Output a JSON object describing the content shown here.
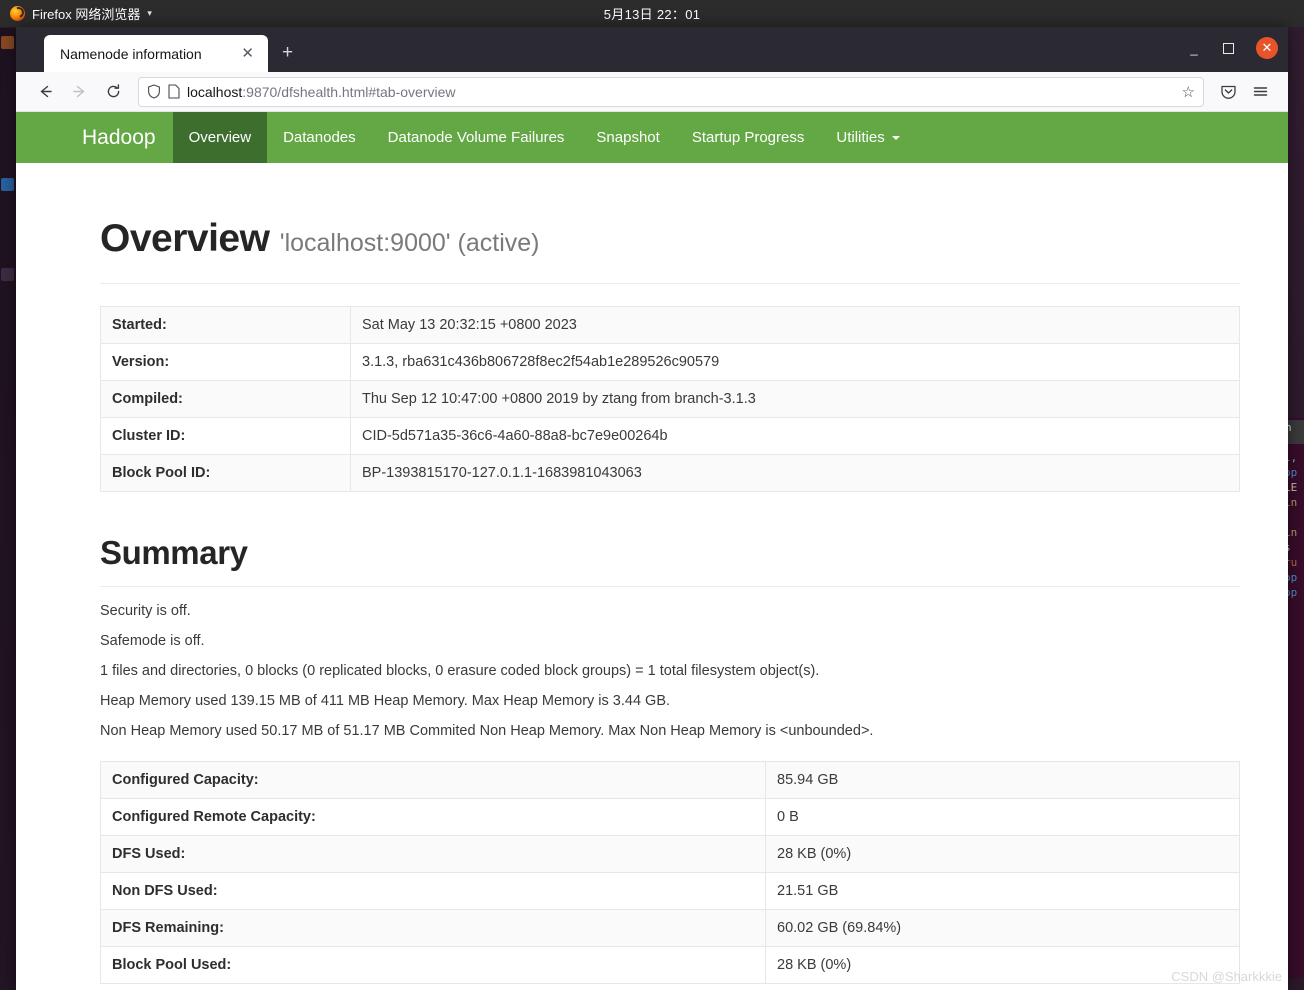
{
  "desktop": {
    "topbar": {
      "app_name": "Firefox 网络浏览器",
      "app_icon": "firefox-icon",
      "menu_caret": "▾",
      "clock": "5月13日 22：01"
    },
    "background_terminal_lines": [
      "h",
      "l,",
      "op",
      "LE",
      "in",
      "in",
      "s",
      "ru",
      "op",
      "op"
    ]
  },
  "browser": {
    "tabs": [
      {
        "title": "Namenode information",
        "close_label": "✕"
      }
    ],
    "new_tab_label": "+",
    "window_controls": {
      "minimize": "—",
      "maximize": "□",
      "close": "✕"
    },
    "toolbar": {
      "back_label": "←",
      "forward_label": "→",
      "reload_label": "⟳",
      "bookmark_label": "☆",
      "pocket_label": "pocket-icon",
      "menu_label": "≡"
    },
    "urlbar": {
      "host": "localhost",
      "path": ":9870/dfshealth.html#tab-overview",
      "shield_icon": "shield-icon",
      "page_icon": "page-icon"
    }
  },
  "hadoop": {
    "brand": "Hadoop",
    "nav": [
      {
        "label": "Overview",
        "active": true
      },
      {
        "label": "Datanodes",
        "active": false
      },
      {
        "label": "Datanode Volume Failures",
        "active": false
      },
      {
        "label": "Snapshot",
        "active": false
      },
      {
        "label": "Startup Progress",
        "active": false
      },
      {
        "label": "Utilities",
        "active": false,
        "dropdown": true
      }
    ],
    "overview": {
      "title": "Overview",
      "subtitle": "'localhost:9000' (active)",
      "rows": [
        {
          "key": "Started:",
          "value": "Sat May 13 20:32:15 +0800 2023"
        },
        {
          "key": "Version:",
          "value": "3.1.3, rba631c436b806728f8ec2f54ab1e289526c90579"
        },
        {
          "key": "Compiled:",
          "value": "Thu Sep 12 10:47:00 +0800 2019 by ztang from branch-3.1.3"
        },
        {
          "key": "Cluster ID:",
          "value": "CID-5d571a35-36c6-4a60-88a8-bc7e9e00264b"
        },
        {
          "key": "Block Pool ID:",
          "value": "BP-1393815170-127.0.1.1-1683981043063"
        }
      ]
    },
    "summary": {
      "title": "Summary",
      "lines": [
        "Security is off.",
        "Safemode is off.",
        "1 files and directories, 0 blocks (0 replicated blocks, 0 erasure coded block groups) = 1 total filesystem object(s).",
        "Heap Memory used 139.15 MB of 411 MB Heap Memory. Max Heap Memory is 3.44 GB.",
        "Non Heap Memory used 50.17 MB of 51.17 MB Commited Non Heap Memory. Max Non Heap Memory is <unbounded>."
      ],
      "rows": [
        {
          "key": "Configured Capacity:",
          "value": "85.94 GB"
        },
        {
          "key": "Configured Remote Capacity:",
          "value": "0 B"
        },
        {
          "key": "DFS Used:",
          "value": "28 KB (0%)"
        },
        {
          "key": "Non DFS Used:",
          "value": "21.51 GB"
        },
        {
          "key": "DFS Remaining:",
          "value": "60.02 GB (69.84%)"
        },
        {
          "key": "Block Pool Used:",
          "value": "28 KB (0%)"
        }
      ]
    }
  },
  "watermark": "CSDN @Sharkkkie",
  "colors": {
    "nav_green": "#63a844",
    "nav_active_green": "#3e6e2e",
    "topbar": "#2c2c2c",
    "tabstrip": "#2b2a33",
    "close_button": "#e8542a"
  }
}
